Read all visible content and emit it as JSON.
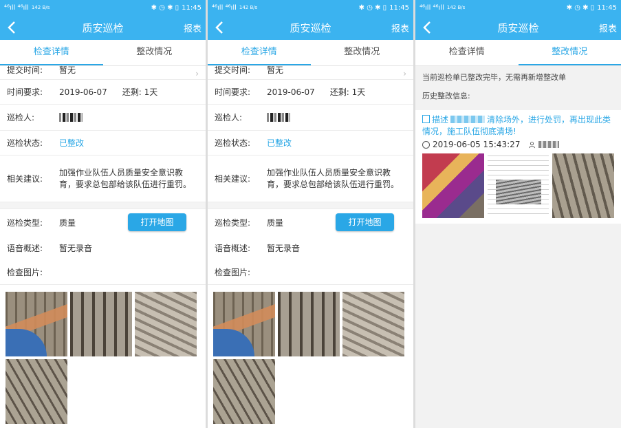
{
  "status_bar": {
    "left": "⁴⁶ıll ⁴⁶ıll",
    "net_speed": "142 B/s",
    "right_icons": "✱ ◷ ✱ ▯",
    "time": "11:45"
  },
  "app": {
    "title": "质安巡检",
    "report_label": "报表"
  },
  "tabs": [
    {
      "label": "检查详情"
    },
    {
      "label": "整改情况"
    }
  ],
  "detail": {
    "submit_label": "提交时间:",
    "submit_value": "暂无",
    "time_label": "时间要求:",
    "time_value": "2019-06-07",
    "remaining": "还剩:  1天",
    "inspector_label": "巡检人:",
    "status_label": "巡检状态:",
    "status_value": "已整改",
    "advice_label": "相关建议:",
    "advice_value": "加强作业队伍人员质量安全意识教育，要求总包部给该队伍进行重罚。",
    "type_label": "巡检类型:",
    "type_value": "质量",
    "map_button": "打开地图",
    "voice_label": "语音概述:",
    "voice_value": "暂无录音",
    "pics_label": "检查图片:"
  },
  "rectify": {
    "notice": "当前巡检单已整改完毕，无需再新增整改单",
    "history_label": "历史整改信息:",
    "desc_prefix": "描述",
    "desc_text": "清除场外，进行处罚，再出现此类情况，施工队伍彻底清场!",
    "time": "2019-06-05 15:43:27"
  },
  "colors": {
    "primary": "#3bb3f0",
    "accent": "#2aa7e6"
  }
}
